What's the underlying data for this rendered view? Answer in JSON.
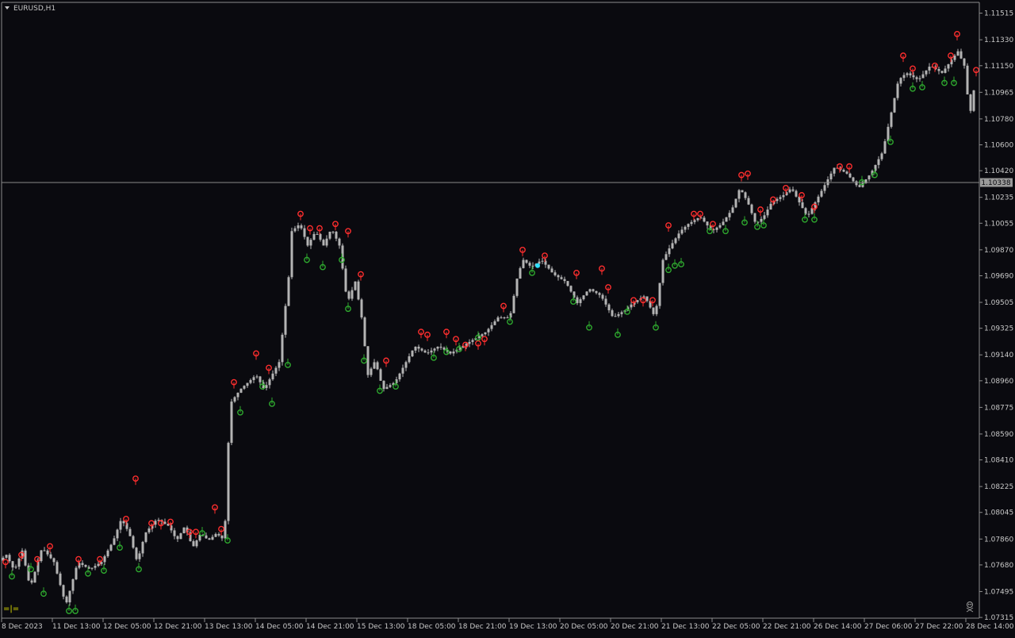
{
  "window": {
    "symbol_label": "EURUSD,H1",
    "current_price_label": "1.10338",
    "expert_label": "=|="
  },
  "colors": {
    "background": "#0a0a0f",
    "axis": "#8c8c8c",
    "candle": "#b4b4b4",
    "up_signal": "#ff2e2e",
    "down_signal": "#2ea82e",
    "price_line": "#8a8a8a",
    "cursor": "#2ee0ff"
  },
  "chart_data": {
    "type": "candlestick",
    "symbol": "EURUSD",
    "timeframe": "H1",
    "y_ticks": [
      "1.11515",
      "1.11330",
      "1.11150",
      "1.10965",
      "1.10780",
      "1.10600",
      "1.10420",
      "1.10235",
      "1.10055",
      "1.09870",
      "1.09690",
      "1.09505",
      "1.09325",
      "1.09140",
      "1.08960",
      "1.08775",
      "1.08590",
      "1.08410",
      "1.08225",
      "1.08045",
      "1.07860",
      "1.07680",
      "1.07495",
      "1.07315"
    ],
    "x_ticks": [
      "8 Dec 2023",
      "11 Dec 13:00",
      "12 Dec 05:00",
      "12 Dec 21:00",
      "13 Dec 13:00",
      "14 Dec 05:00",
      "14 Dec 21:00",
      "15 Dec 13:00",
      "18 Dec 05:00",
      "18 Dec 21:00",
      "19 Dec 13:00",
      "20 Dec 05:00",
      "20 Dec 21:00",
      "21 Dec 13:00",
      "22 Dec 05:00",
      "22 Dec 21:00",
      "26 Dec 14:00",
      "27 Dec 06:00",
      "27 Dec 22:00",
      "28 Dec 14:00"
    ],
    "ylim": [
      1.0731,
      1.1159
    ],
    "current_price": 1.10338,
    "price_path": [
      [
        1.077,
        0
      ],
      [
        1.0775,
        10
      ],
      [
        1.0764,
        20
      ],
      [
        1.0778,
        30
      ],
      [
        1.0752,
        40
      ],
      [
        1.078,
        55
      ],
      [
        1.077,
        70
      ],
      [
        1.075,
        80
      ],
      [
        1.074,
        85
      ],
      [
        1.077,
        100
      ],
      [
        1.0765,
        115
      ],
      [
        1.077,
        130
      ],
      [
        1.0785,
        145
      ],
      [
        1.08,
        155
      ],
      [
        1.079,
        165
      ],
      [
        1.077,
        175
      ],
      [
        1.079,
        185
      ],
      [
        1.08,
        200
      ],
      [
        1.0795,
        215
      ],
      [
        1.0785,
        225
      ],
      [
        1.0795,
        235
      ],
      [
        1.078,
        245
      ],
      [
        1.079,
        255
      ],
      [
        1.0785,
        265
      ],
      [
        1.079,
        275
      ],
      [
        1.0785,
        285
      ],
      [
        1.088,
        292
      ],
      [
        1.089,
        305
      ],
      [
        1.0895,
        315
      ],
      [
        1.09,
        325
      ],
      [
        1.089,
        335
      ],
      [
        1.09,
        345
      ],
      [
        1.091,
        355
      ],
      [
        1.094,
        360
      ],
      [
        1.096,
        365
      ],
      [
        1.1,
        370
      ],
      [
        1.1005,
        380
      ],
      [
        1.099,
        390
      ],
      [
        1.1,
        400
      ],
      [
        1.099,
        410
      ],
      [
        1.1002,
        420
      ],
      [
        1.099,
        430
      ],
      [
        1.095,
        440
      ],
      [
        1.0965,
        450
      ],
      [
        1.094,
        458
      ],
      [
        1.09,
        466
      ],
      [
        1.091,
        475
      ],
      [
        1.089,
        485
      ],
      [
        1.0895,
        500
      ],
      [
        1.091,
        515
      ],
      [
        1.092,
        525
      ],
      [
        1.0915,
        540
      ],
      [
        1.092,
        555
      ],
      [
        1.0915,
        570
      ],
      [
        1.092,
        585
      ],
      [
        1.0925,
        600
      ],
      [
        1.093,
        615
      ],
      [
        1.094,
        630
      ],
      [
        1.094,
        645
      ],
      [
        1.097,
        655
      ],
      [
        1.098,
        662
      ],
      [
        1.0975,
        672
      ],
      [
        1.098,
        685
      ],
      [
        1.097,
        700
      ],
      [
        1.0965,
        715
      ],
      [
        1.095,
        730
      ],
      [
        1.096,
        745
      ],
      [
        1.0955,
        760
      ],
      [
        1.094,
        775
      ],
      [
        1.0945,
        790
      ],
      [
        1.095,
        800
      ],
      [
        1.0955,
        815
      ],
      [
        1.094,
        828
      ],
      [
        1.098,
        838
      ],
      [
        1.099,
        848
      ],
      [
        1.1,
        860
      ],
      [
        1.1005,
        870
      ],
      [
        1.101,
        885
      ],
      [
        1.1,
        900
      ],
      [
        1.1005,
        912
      ],
      [
        1.1015,
        925
      ],
      [
        1.103,
        935
      ],
      [
        1.102,
        945
      ],
      [
        1.1005,
        955
      ],
      [
        1.101,
        965
      ],
      [
        1.102,
        975
      ],
      [
        1.1025,
        990
      ],
      [
        1.103,
        1000
      ],
      [
        1.102,
        1010
      ],
      [
        1.101,
        1020
      ],
      [
        1.102,
        1030
      ],
      [
        1.1035,
        1045
      ],
      [
        1.1045,
        1055
      ],
      [
        1.104,
        1070
      ],
      [
        1.103,
        1085
      ],
      [
        1.104,
        1100
      ],
      [
        1.1055,
        1115
      ],
      [
        1.108,
        1125
      ],
      [
        1.1105,
        1135
      ],
      [
        1.111,
        1145
      ],
      [
        1.1105,
        1160
      ],
      [
        1.1115,
        1175
      ],
      [
        1.111,
        1190
      ],
      [
        1.1125,
        1210
      ],
      [
        1.1115,
        1218
      ],
      [
        1.108,
        1225
      ],
      [
        1.1105,
        1232
      ]
    ],
    "up_signals": [
      [
        1.077,
        7
      ],
      [
        1.0775,
        27
      ],
      [
        1.0772,
        47
      ],
      [
        1.0781,
        63
      ],
      [
        1.0772,
        99
      ],
      [
        1.0772,
        126
      ],
      [
        1.08,
        159
      ],
      [
        1.0828,
        171
      ],
      [
        1.0797,
        191
      ],
      [
        1.0797,
        203
      ],
      [
        1.0798,
        215
      ],
      [
        1.0791,
        239
      ],
      [
        1.0791,
        247
      ],
      [
        1.0808,
        271
      ],
      [
        1.0793,
        279
      ],
      [
        1.0895,
        295
      ],
      [
        1.0915,
        323
      ],
      [
        1.0905,
        339
      ],
      [
        1.1012,
        379
      ],
      [
        1.1002,
        391
      ],
      [
        1.1002,
        403
      ],
      [
        1.1005,
        423
      ],
      [
        1.1,
        439
      ],
      [
        1.097,
        455
      ],
      [
        1.091,
        487
      ],
      [
        1.093,
        531
      ],
      [
        1.0928,
        539
      ],
      [
        1.093,
        563
      ],
      [
        1.0925,
        575
      ],
      [
        1.0921,
        587
      ],
      [
        1.0922,
        603
      ],
      [
        1.0925,
        611
      ],
      [
        1.0948,
        635
      ],
      [
        1.0987,
        659
      ],
      [
        1.0983,
        687
      ],
      [
        1.0971,
        727
      ],
      [
        1.0974,
        759
      ],
      [
        1.0961,
        767
      ],
      [
        1.0952,
        799
      ],
      [
        1.0952,
        811
      ],
      [
        1.0952,
        823
      ],
      [
        1.1004,
        843
      ],
      [
        1.1012,
        875
      ],
      [
        1.1012,
        883
      ],
      [
        1.1005,
        899
      ],
      [
        1.1039,
        935
      ],
      [
        1.104,
        943
      ],
      [
        1.1015,
        959
      ],
      [
        1.1022,
        975
      ],
      [
        1.103,
        991
      ],
      [
        1.1025,
        1011
      ],
      [
        1.1017,
        1027
      ],
      [
        1.1045,
        1059
      ],
      [
        1.1045,
        1071
      ],
      [
        1.1122,
        1139
      ],
      [
        1.1113,
        1151
      ],
      [
        1.1115,
        1179
      ],
      [
        1.1122,
        1199
      ],
      [
        1.1137,
        1207
      ],
      [
        1.1112,
        1231
      ]
    ],
    "down_signals": [
      [
        1.076,
        15
      ],
      [
        1.0765,
        39
      ],
      [
        1.0748,
        55
      ],
      [
        1.0736,
        87
      ],
      [
        1.0736,
        95
      ],
      [
        1.0762,
        111
      ],
      [
        1.0764,
        131
      ],
      [
        1.078,
        151
      ],
      [
        1.0765,
        175
      ],
      [
        1.079,
        255
      ],
      [
        1.0785,
        287
      ],
      [
        1.0874,
        303
      ],
      [
        1.0892,
        331
      ],
      [
        1.088,
        343
      ],
      [
        1.0907,
        363
      ],
      [
        1.098,
        387
      ],
      [
        1.0975,
        407
      ],
      [
        1.098,
        431
      ],
      [
        1.0946,
        439
      ],
      [
        1.091,
        459
      ],
      [
        1.0889,
        479
      ],
      [
        1.0892,
        499
      ],
      [
        1.0912,
        547
      ],
      [
        1.0916,
        563
      ],
      [
        1.0918,
        579
      ],
      [
        1.0926,
        603
      ],
      [
        1.0937,
        643
      ],
      [
        1.0971,
        671
      ],
      [
        1.0951,
        723
      ],
      [
        1.0933,
        743
      ],
      [
        1.0928,
        779
      ],
      [
        1.0944,
        791
      ],
      [
        1.0933,
        827
      ],
      [
        1.0973,
        843
      ],
      [
        1.0976,
        851
      ],
      [
        1.0977,
        859
      ],
      [
        1.1,
        895
      ],
      [
        1.1,
        915
      ],
      [
        1.1006,
        939
      ],
      [
        1.1003,
        955
      ],
      [
        1.1004,
        963
      ],
      [
        1.1008,
        1015
      ],
      [
        1.1008,
        1027
      ],
      [
        1.1034,
        1087
      ],
      [
        1.1039,
        1103
      ],
      [
        1.1062,
        1123
      ],
      [
        1.1099,
        1151
      ],
      [
        1.11,
        1163
      ],
      [
        1.1103,
        1191
      ],
      [
        1.1103,
        1203
      ]
    ]
  }
}
